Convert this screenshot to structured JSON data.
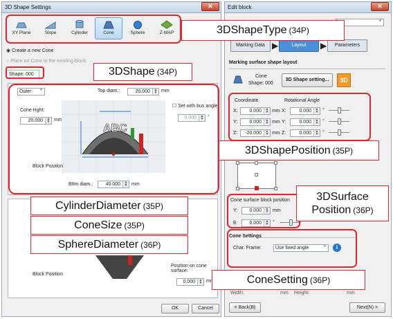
{
  "left_window": {
    "title": "3D Shape Settings",
    "toolbar": [
      "XY Plane",
      "Slope",
      "Cylinder",
      "Cone",
      "Sphere",
      "Z-MAP"
    ],
    "radio_create": "Create a new Cone",
    "radio_place": "Place on Cone in the existing block",
    "shape_label": "Shape: 000",
    "side_select": "Outer",
    "top_diam_label": "Top diam.:",
    "top_diam_value": "20.000",
    "top_diam_unit": "mm",
    "cone_height_label": "Cone Hght:",
    "cone_height_value": "20.000",
    "cone_height_unit": "mm",
    "bus_angle_label": "Set with bus angle",
    "bus_angle_value": "0.000",
    "bus_angle_unit": "°",
    "block_position_label": "Block Position",
    "bottom_diam_label": "Bttm diam.:",
    "bottom_diam_value": "40.000",
    "bottom_diam_unit": "mm",
    "block_position_label2": "Block Position",
    "position_on_cone_label": "Position on cone surface:",
    "position_on_cone_value": "0.000",
    "position_on_cone_unit": "mm",
    "ok": "OK",
    "cancel": "Cancel",
    "image_text": "ABC"
  },
  "right_window": {
    "title": "Edit block",
    "steps": [
      "Marking Data",
      "Layout",
      "Parameters"
    ],
    "section_title": "Marking surface shape layout",
    "cone_label": "Cone",
    "shape_label": "Shape: 000",
    "shape_setting_button": "3D Shape setting...",
    "badge_3d": "3D",
    "coordinate_label": "Coordinate",
    "rot_angle_label": "Rotational Angle",
    "coords": [
      {
        "axis": "X:",
        "value": "0.000",
        "unit": "mm",
        "rot_axis": "X:",
        "rot_value": "0.000",
        "rot_unit": "°"
      },
      {
        "axis": "Y:",
        "value": "0.000",
        "unit": "mm",
        "rot_axis": "Y:",
        "rot_value": "0.000",
        "rot_unit": "°"
      },
      {
        "axis": "Z:",
        "value": "-20.000",
        "unit": "mm",
        "rot_axis": "Z:",
        "rot_value": "0.000",
        "rot_unit": "°"
      }
    ],
    "surface_pos_label": "Cone surface block position",
    "surface_y_label": "Y:",
    "surface_y_value": "0.000",
    "surface_y_unit": "mm",
    "surface_theta_label": "θ:",
    "surface_theta_value": "0.000",
    "surface_theta_unit": "°",
    "cone_settings_title": "Cone Settings",
    "char_frame_label": "Char. Frame:",
    "char_frame_value": "Use fixed angle",
    "width_label": "Width:",
    "width_unit": "mm",
    "height_label": "Height:",
    "height_unit": "mm",
    "back": "< Back(B)",
    "next": "Next(N) >"
  },
  "callouts": {
    "shape_type": {
      "name": "3DShapeType",
      "page": "(34P)"
    },
    "shape": {
      "name": "3DShape",
      "page": "(34P)"
    },
    "cylinder_diameter": {
      "name": "CylinderDiameter",
      "page": "(35P)"
    },
    "cone_size": {
      "name": "ConeSize",
      "page": "(35P)"
    },
    "sphere_diameter": {
      "name": "SphereDiameter",
      "page": "(36P)"
    },
    "shape_position": {
      "name": "3DShapePosition",
      "page": "(35P)"
    },
    "surface_position_line1": "3DSurface",
    "surface_position_line2": "Position",
    "surface_position_page": "(36P)",
    "cone_setting": {
      "name": "ConeSetting",
      "page": "(36P)"
    }
  },
  "colors": {
    "callout_border": "#e0252d",
    "selected_step": "#4a90d9"
  }
}
